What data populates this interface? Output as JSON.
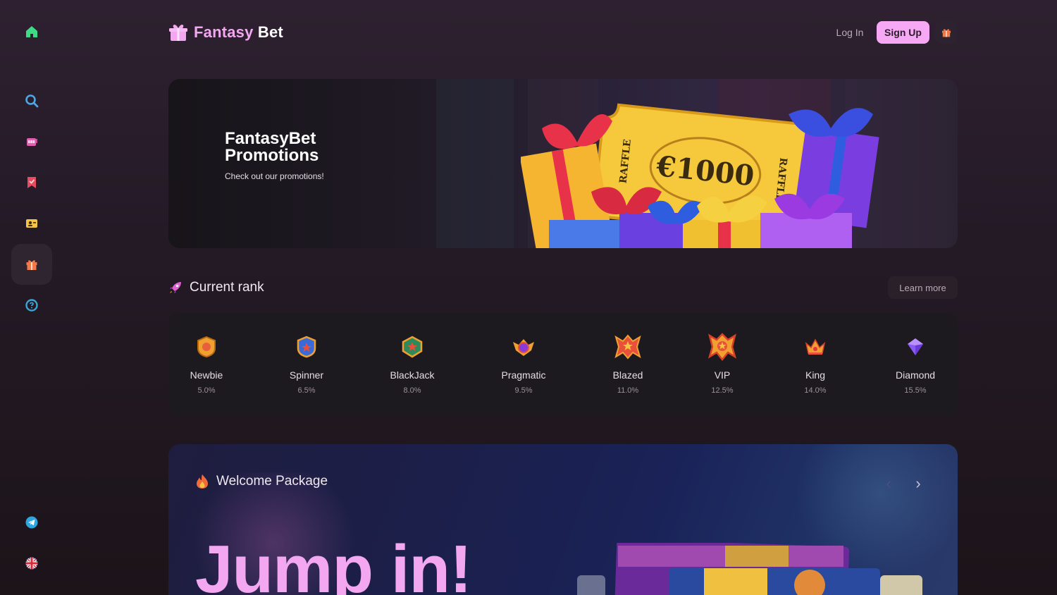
{
  "sidebar": {
    "items": [
      {
        "name": "home-icon",
        "color": "#3ddc84"
      },
      {
        "name": "search-icon",
        "color": "#4aa8e8"
      },
      {
        "name": "slots-icon",
        "color": "#e05fb0"
      },
      {
        "name": "bookmark-icon",
        "color": "#e84a5f"
      },
      {
        "name": "live-casino-icon",
        "color": "#f5c542"
      },
      {
        "name": "gift-icon",
        "color": "#f07a4a",
        "active": true
      },
      {
        "name": "support-icon",
        "color": "#3aa6d8"
      }
    ],
    "bottom": [
      {
        "name": "telegram-icon",
        "color": "#2ca5e0"
      },
      {
        "name": "uk-flag-icon"
      }
    ]
  },
  "header": {
    "logo_part1": "Fantasy",
    "logo_part2": " Bet",
    "login_label": "Log In",
    "signup_label": "Sign Up"
  },
  "banner": {
    "title": "FantasyBet Promotions",
    "subtitle": "Check out our promotions!",
    "ticket_amount": "€1000",
    "ticket_side_label": "RAFFLE"
  },
  "rank": {
    "title": "Current rank",
    "learn_more_label": "Learn more",
    "levels": [
      {
        "name": "Newbie",
        "percent": "5.0%"
      },
      {
        "name": "Spinner",
        "percent": "6.5%"
      },
      {
        "name": "BlackJack",
        "percent": "8.0%"
      },
      {
        "name": "Pragmatic",
        "percent": "9.5%"
      },
      {
        "name": "Blazed",
        "percent": "11.0%"
      },
      {
        "name": "VIP",
        "percent": "12.5%"
      },
      {
        "name": "King",
        "percent": "14.0%"
      },
      {
        "name": "Diamond",
        "percent": "15.5%"
      }
    ]
  },
  "welcome": {
    "title": "Welcome Package",
    "headline": "Jump in!",
    "prev_icon": "‹",
    "next_icon": "›"
  },
  "colors": {
    "accent_pink": "#f7a8f4",
    "background": "#241a26",
    "panel": "#1c1a1f"
  }
}
